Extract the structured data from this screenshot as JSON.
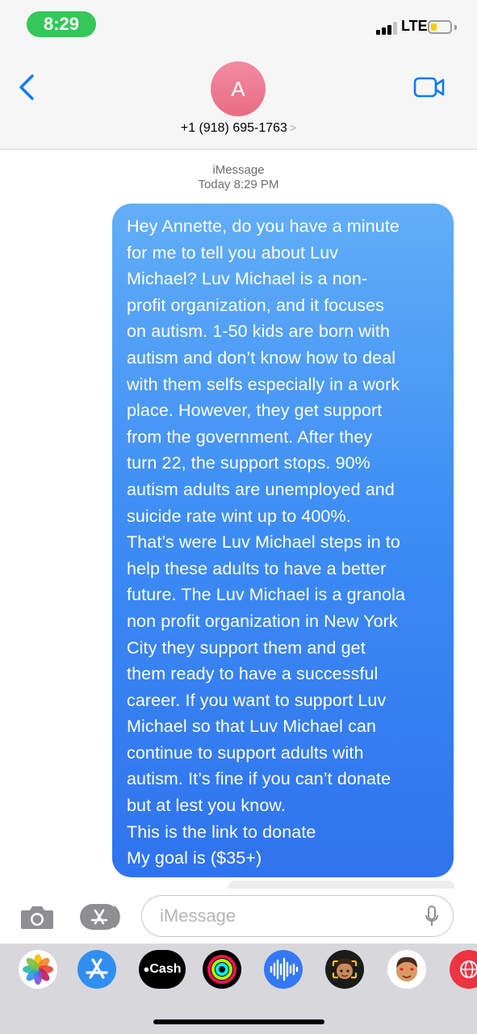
{
  "status_bar": {
    "time": "8:29",
    "network": "LTE",
    "battery_level": 0.3
  },
  "header": {
    "back_icon": "chevron-left-icon",
    "avatar_initial": "A",
    "contact_number": "+1 (918) 695-1763",
    "contact_chevron": ">",
    "video_icon": "video-camera-icon"
  },
  "thread": {
    "service": "iMessage",
    "timestamp": "Today 8:29 PM",
    "message_lines": [
      "Hey Annette, do you have a minute",
      "for me to tell you about Luv",
      "Michael? Luv Michael is a non-",
      "profit organization, and it focuses",
      "on autism. 1-50 kids are born with",
      "autism and don’t know how to deal",
      "with them selfs especially in a work",
      "place. However, they get support",
      "from the government. After they",
      "turn 22, the support stops. 90%",
      "autism adults are unemployed and",
      "suicide rate wint up to 400%.",
      "That’s were Luv Michael steps in to",
      "help these adults to have a better",
      "future. The Luv Michael is a granola",
      "non profit organization in New York",
      "City they support them and get",
      "them ready to have a successful",
      "career. If you want to support Luv",
      "Michael so that Luv Michael can",
      "continue to support adults with",
      "autism. It’s fine if you can’t donate",
      "but at lest you know.",
      "This is the link to donate",
      "My goal is ($35+)"
    ]
  },
  "composer": {
    "camera_icon": "camera-icon",
    "apps_icon": "app-store-icon",
    "placeholder": "iMessage",
    "mic_icon": "microphone-icon"
  },
  "app_drawer": {
    "apps": [
      "photos-icon",
      "app-store-icon",
      "apple-cash-icon",
      "activity-icon",
      "audio-message-icon",
      "memoji-icon",
      "memoji-stickers-icon",
      "web-icon"
    ],
    "cash_label": "Cash"
  },
  "colors": {
    "accent": "#007aff",
    "bubble": "#3e8ef5",
    "status_pill": "#34c759",
    "avatar": "#e86d84"
  }
}
